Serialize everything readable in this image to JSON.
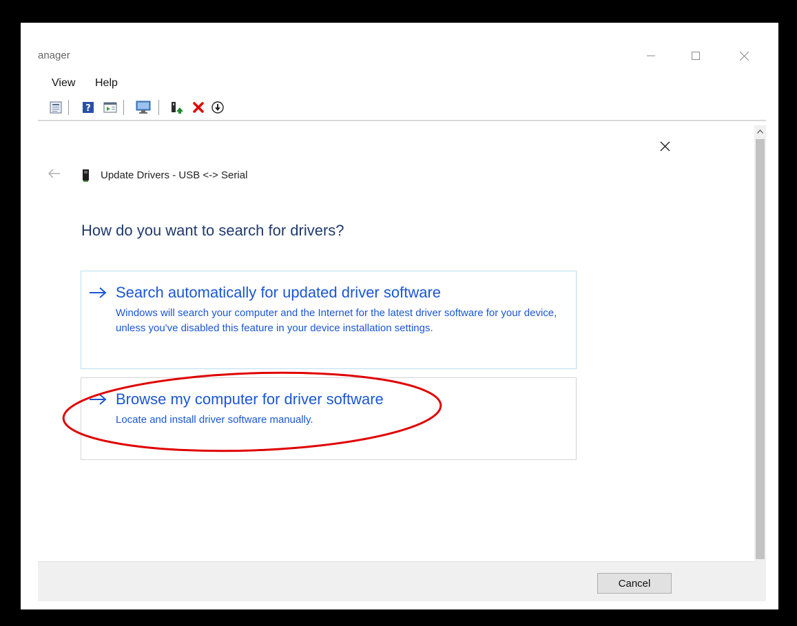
{
  "window": {
    "title": "anager",
    "minimize_icon": "minimize-icon",
    "maximize_icon": "maximize-icon",
    "close_icon": "close-icon"
  },
  "menubar": {
    "items": [
      {
        "label": "View"
      },
      {
        "label": "Help"
      }
    ]
  },
  "toolbar": {
    "icons": [
      "properties-icon",
      "help-icon",
      "view-icon",
      "scan-hardware-icon",
      "update-driver-icon",
      "uninstall-icon",
      "download-icon"
    ],
    "colors": {
      "uninstall": "#e00000",
      "update": "#1b8a2a"
    }
  },
  "dialog": {
    "title": "Update Drivers - USB <-> Serial",
    "heading": "How do you want to search for drivers?",
    "options": [
      {
        "title": "Search automatically for updated driver software",
        "description": "Windows will search your computer and the Internet for the latest driver software for your device, unless you've disabled this feature in your device installation settings."
      },
      {
        "title": "Browse my computer for driver software",
        "description": "Locate and install driver software manually."
      }
    ],
    "cancel_label": "Cancel",
    "link_color": "#1a56d6",
    "annotation_color": "#e00000"
  }
}
